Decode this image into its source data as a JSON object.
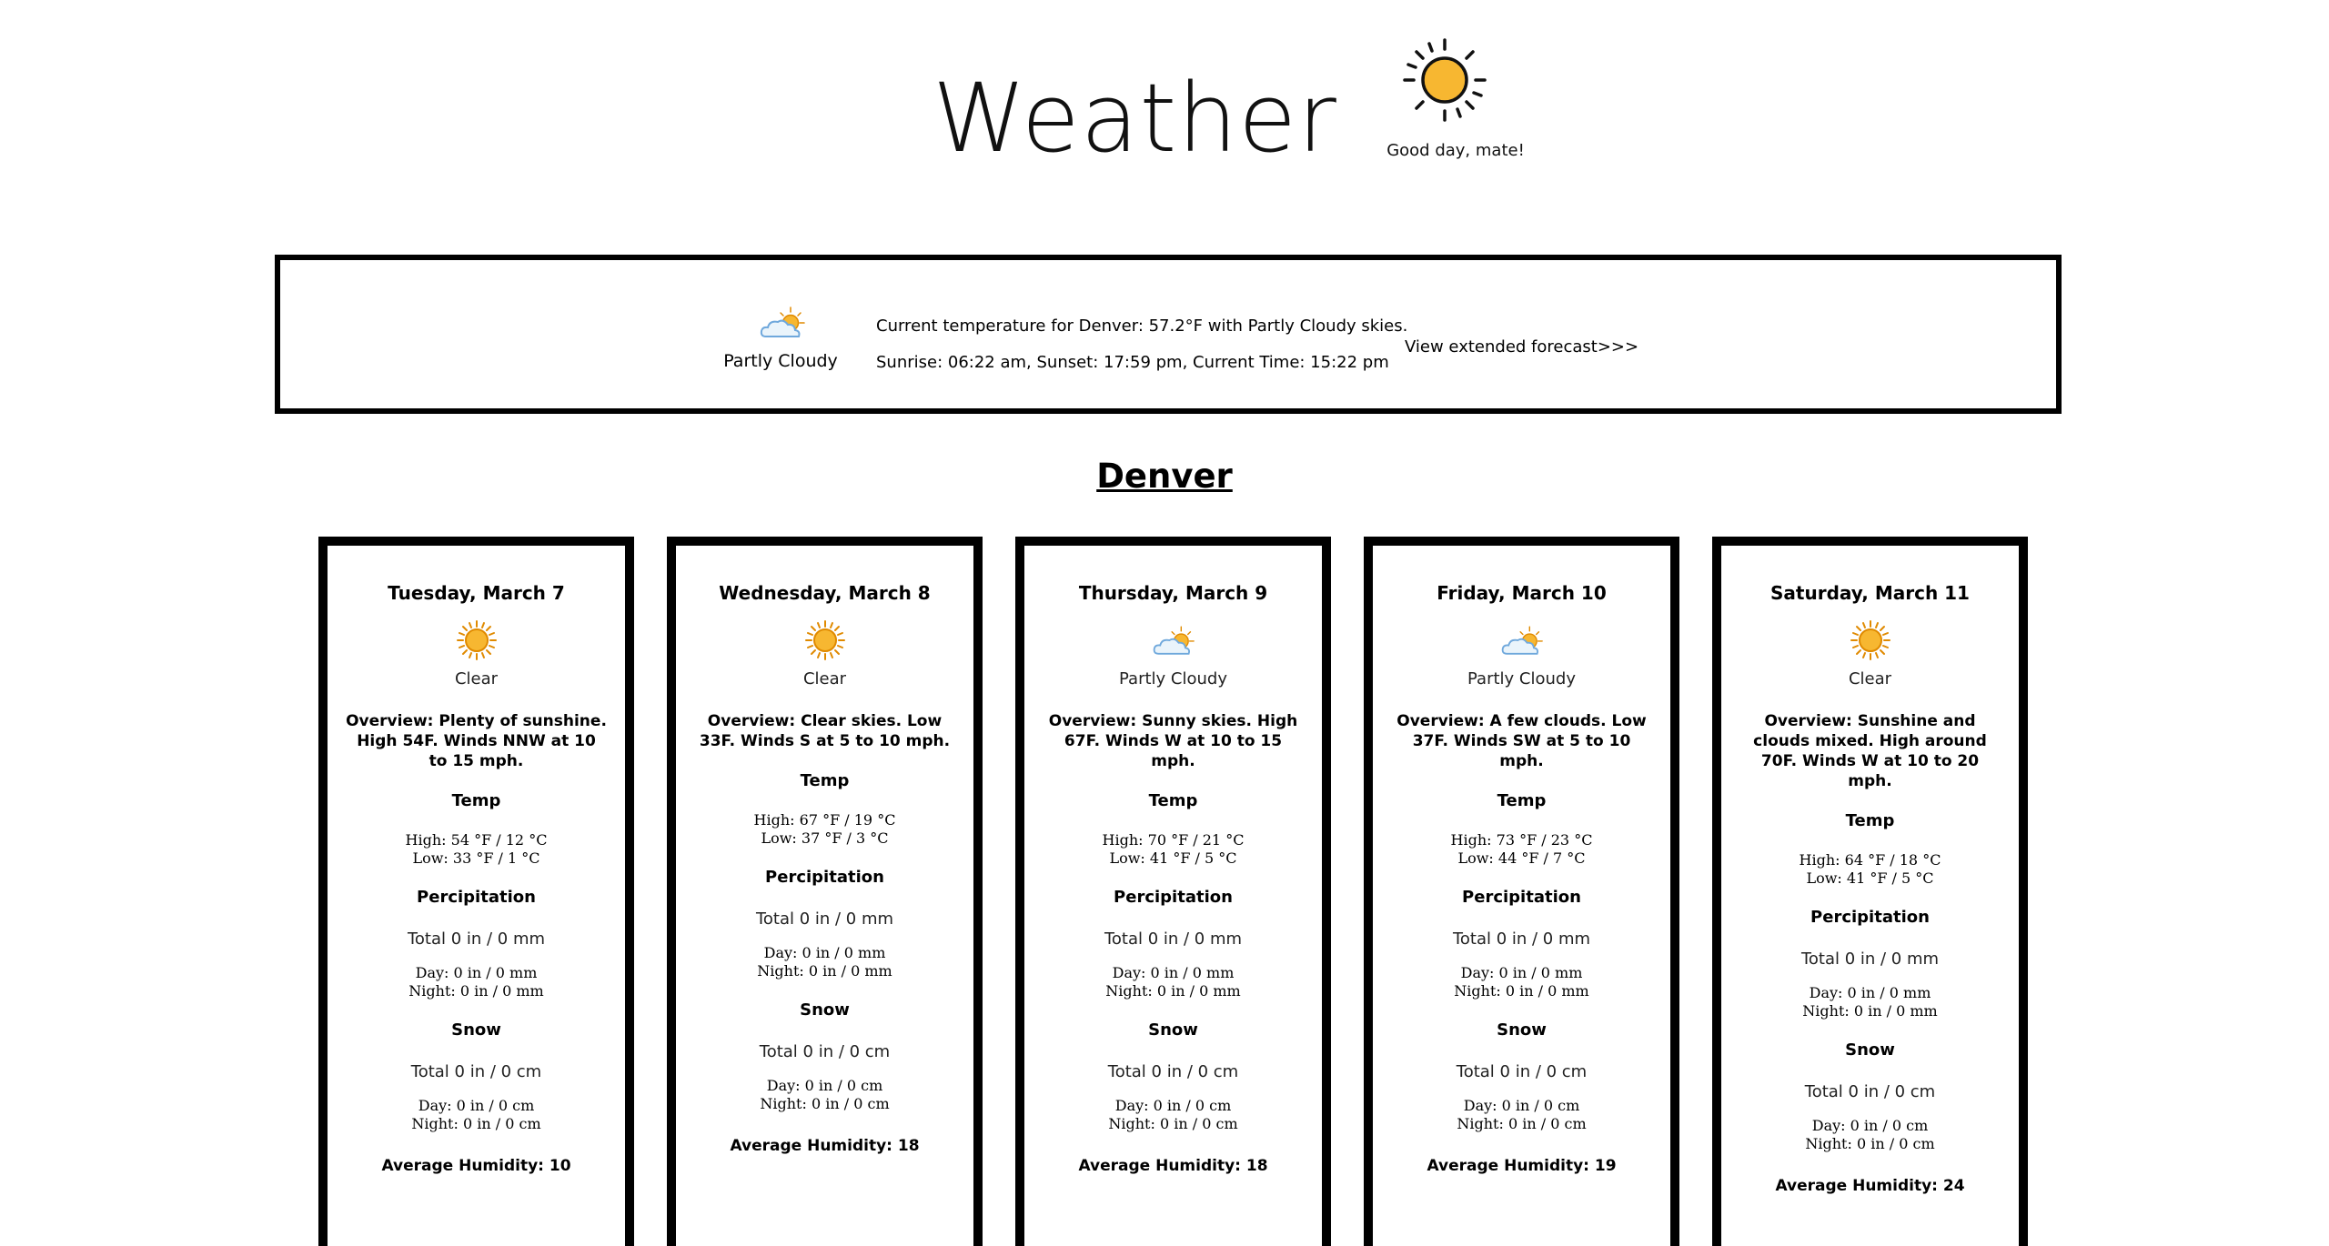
{
  "header": {
    "title": "Weather",
    "greeting": "Good day, mate!",
    "logo_icon": "sun-icon"
  },
  "current": {
    "icon": "partly-cloudy-icon",
    "condition": "Partly Cloudy",
    "temp_line": "Current temperature for Denver: 57.2°F with Partly Cloudy skies.",
    "sun_line": "Sunrise: 06:22 am, Sunset: 17:59 pm, Current Time: 15:22 pm",
    "extended_link": "View extended forecast>>>"
  },
  "city": "Denver",
  "labels": {
    "temp": "Temp",
    "precip": "Percipitation",
    "snow": "Snow"
  },
  "days": [
    {
      "title": "Tuesday, March 7",
      "icon": "sun-icon",
      "condition": "Clear",
      "overview": "Overview: Plenty of sunshine. High 54F. Winds NNW at 10 to 15 mph.",
      "high": "High: 54 °F / 12 °C",
      "low": "Low: 33 °F / 1 °C",
      "precip_total": "Total 0 in / 0 mm",
      "precip_day": "Day: 0 in / 0 mm",
      "precip_night": "Night: 0 in / 0 mm",
      "snow_total": "Total 0 in / 0 cm",
      "snow_day": "Day: 0 in / 0 cm",
      "snow_night": "Night: 0 in / 0 cm",
      "humidity": "Average Humidity: 10"
    },
    {
      "title": "Wednesday, March 8",
      "icon": "sun-icon",
      "condition": "Clear",
      "overview": "Overview: Clear skies. Low 33F. Winds S at 5 to 10 mph.",
      "high": "High: 67 °F / 19 °C",
      "low": "Low: 37 °F / 3 °C",
      "precip_total": "Total 0 in / 0 mm",
      "precip_day": "Day: 0 in / 0 mm",
      "precip_night": "Night: 0 in / 0 mm",
      "snow_total": "Total 0 in / 0 cm",
      "snow_day": "Day: 0 in / 0 cm",
      "snow_night": "Night: 0 in / 0 cm",
      "humidity": "Average Humidity: 18"
    },
    {
      "title": "Thursday, March 9",
      "icon": "partly-cloudy-icon",
      "condition": "Partly Cloudy",
      "overview": "Overview: Sunny skies. High 67F. Winds W at 10 to 15 mph.",
      "high": "High: 70 °F / 21 °C",
      "low": "Low: 41 °F / 5 °C",
      "precip_total": "Total 0 in / 0 mm",
      "precip_day": "Day: 0 in / 0 mm",
      "precip_night": "Night: 0 in / 0 mm",
      "snow_total": "Total 0 in / 0 cm",
      "snow_day": "Day: 0 in / 0 cm",
      "snow_night": "Night: 0 in / 0 cm",
      "humidity": "Average Humidity: 18"
    },
    {
      "title": "Friday, March 10",
      "icon": "partly-cloudy-icon",
      "condition": "Partly Cloudy",
      "overview": "Overview: A few clouds. Low 37F. Winds SW at 5 to 10 mph.",
      "high": "High: 73 °F / 23 °C",
      "low": "Low: 44 °F / 7 °C",
      "precip_total": "Total 0 in / 0 mm",
      "precip_day": "Day: 0 in / 0 mm",
      "precip_night": "Night: 0 in / 0 mm",
      "snow_total": "Total 0 in / 0 cm",
      "snow_day": "Day: 0 in / 0 cm",
      "snow_night": "Night: 0 in / 0 cm",
      "humidity": "Average Humidity: 19"
    },
    {
      "title": "Saturday, March 11",
      "icon": "sun-icon",
      "condition": "Clear",
      "overview": "Overview: Sunshine and clouds mixed. High around 70F. Winds W at 10 to 20 mph.",
      "high": "High: 64 °F / 18 °C",
      "low": "Low: 41 °F / 5 °C",
      "precip_total": "Total 0 in / 0 mm",
      "precip_day": "Day: 0 in / 0 mm",
      "precip_night": "Night: 0 in / 0 mm",
      "snow_total": "Total 0 in / 0 cm",
      "snow_day": "Day: 0 in / 0 cm",
      "snow_night": "Night: 0 in / 0 cm",
      "humidity": "Average Humidity: 24"
    }
  ],
  "colors": {
    "sun_fill": "#F7B731",
    "sun_stroke": "#E08A00",
    "cloud": "#EAF4FB",
    "cloud_stroke": "#6FA8DC",
    "border": "#000000"
  }
}
